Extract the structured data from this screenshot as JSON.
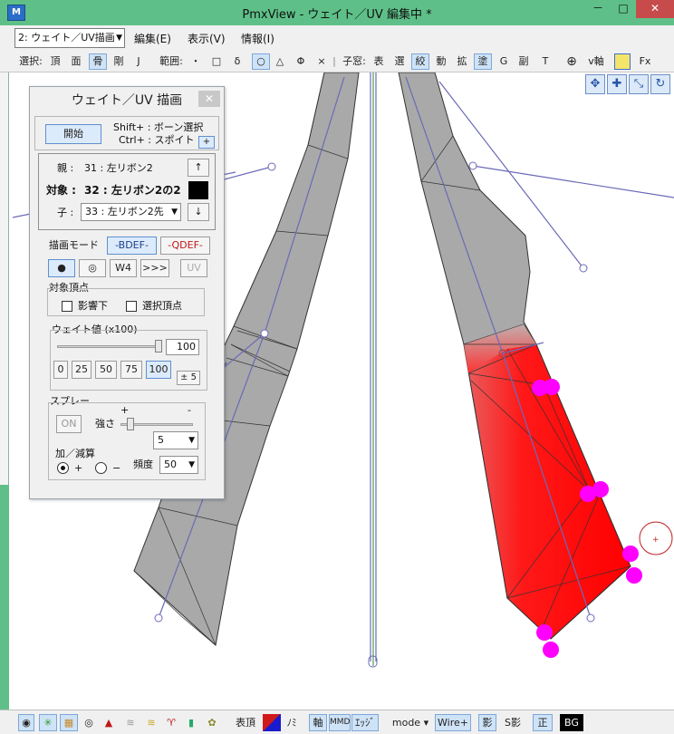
{
  "window": {
    "title": "PmxView  - ウェイト／UV 編集中 *",
    "minimize": "－",
    "maximize": "□",
    "close": "✕"
  },
  "menubar": {
    "mode_select": "2: ウェイト／UV描画",
    "items": [
      "編集(E)",
      "表示(V)",
      "情報(I)"
    ]
  },
  "toolbar": {
    "select_label": "選択:",
    "select_items": [
      "頂",
      "面",
      "骨",
      "剛",
      "J"
    ],
    "range_label": "範囲:",
    "range_items": [
      "・",
      "□",
      "δ",
      "○",
      "△",
      "Φ",
      "×"
    ],
    "child_window_label": "子窓:",
    "child_items": [
      "表",
      "選",
      "絞",
      "動",
      "拡",
      "塗",
      "G",
      "副",
      "T"
    ],
    "v_axis": "v軸",
    "fx": "Fx"
  },
  "panel": {
    "title": "ウェイト／UV 描画",
    "close": "✕",
    "start_button": "開始",
    "hint_shift": "Shift+ : ボーン選択",
    "hint_ctrl": "Ctrl+ : スポイト",
    "plus": "+",
    "parent_label": "親 :",
    "parent_value": "31 : 左リボン2",
    "target_label": "対象 :",
    "target_value": "32 : 左リボン2の2",
    "child_label": "子 :",
    "child_value": "33 : 左リボン2先",
    "up_arrow": "↑",
    "down_arrow": "↓",
    "draw_mode_label": "描画モード",
    "bdef": "-BDEF-",
    "qdef": "-QDEF-",
    "brush_buttons": [
      "●",
      "◎",
      "W4",
      ">>>",
      "UV"
    ],
    "target_vertex_label": "対象頂点",
    "influence_label": "影響下",
    "selected_vertex_label": "選択頂点",
    "weight_label": "ウェイト値 (x100)",
    "weight_value": "100",
    "weight_presets": [
      "0",
      "25",
      "50",
      "75",
      "100"
    ],
    "weight_step": "± 5",
    "spray_label": "スプレー",
    "spray_plus": "+",
    "spray_minus": "-",
    "spray_on": "ON",
    "strength_label": "強さ",
    "strength_value": "5",
    "addsub_label": "加／減算",
    "add_label": "+",
    "sub_label": "−",
    "frequency_label": "頻度",
    "frequency_value": "50",
    "weight_slider_fraction": 1.0,
    "strength_slider_fraction": 0.1
  },
  "statusbar": {
    "vertex": "表頂",
    "no": "ﾉﾐ",
    "axis": "軸",
    "mmd": "MMD",
    "edge": "ｴｯｼﾞ",
    "mode": "mode",
    "wire": "Wire+",
    "shadow": "影",
    "sshadow": "S影",
    "ortho": "正",
    "bg": "BG"
  },
  "colors": {
    "titlebar": "#5ec088",
    "weight_red": "#ff0000",
    "selected_vertex": "#ff00ff",
    "model_gray": "#a9a9a9",
    "bone_blue": "#6a6ab8"
  }
}
